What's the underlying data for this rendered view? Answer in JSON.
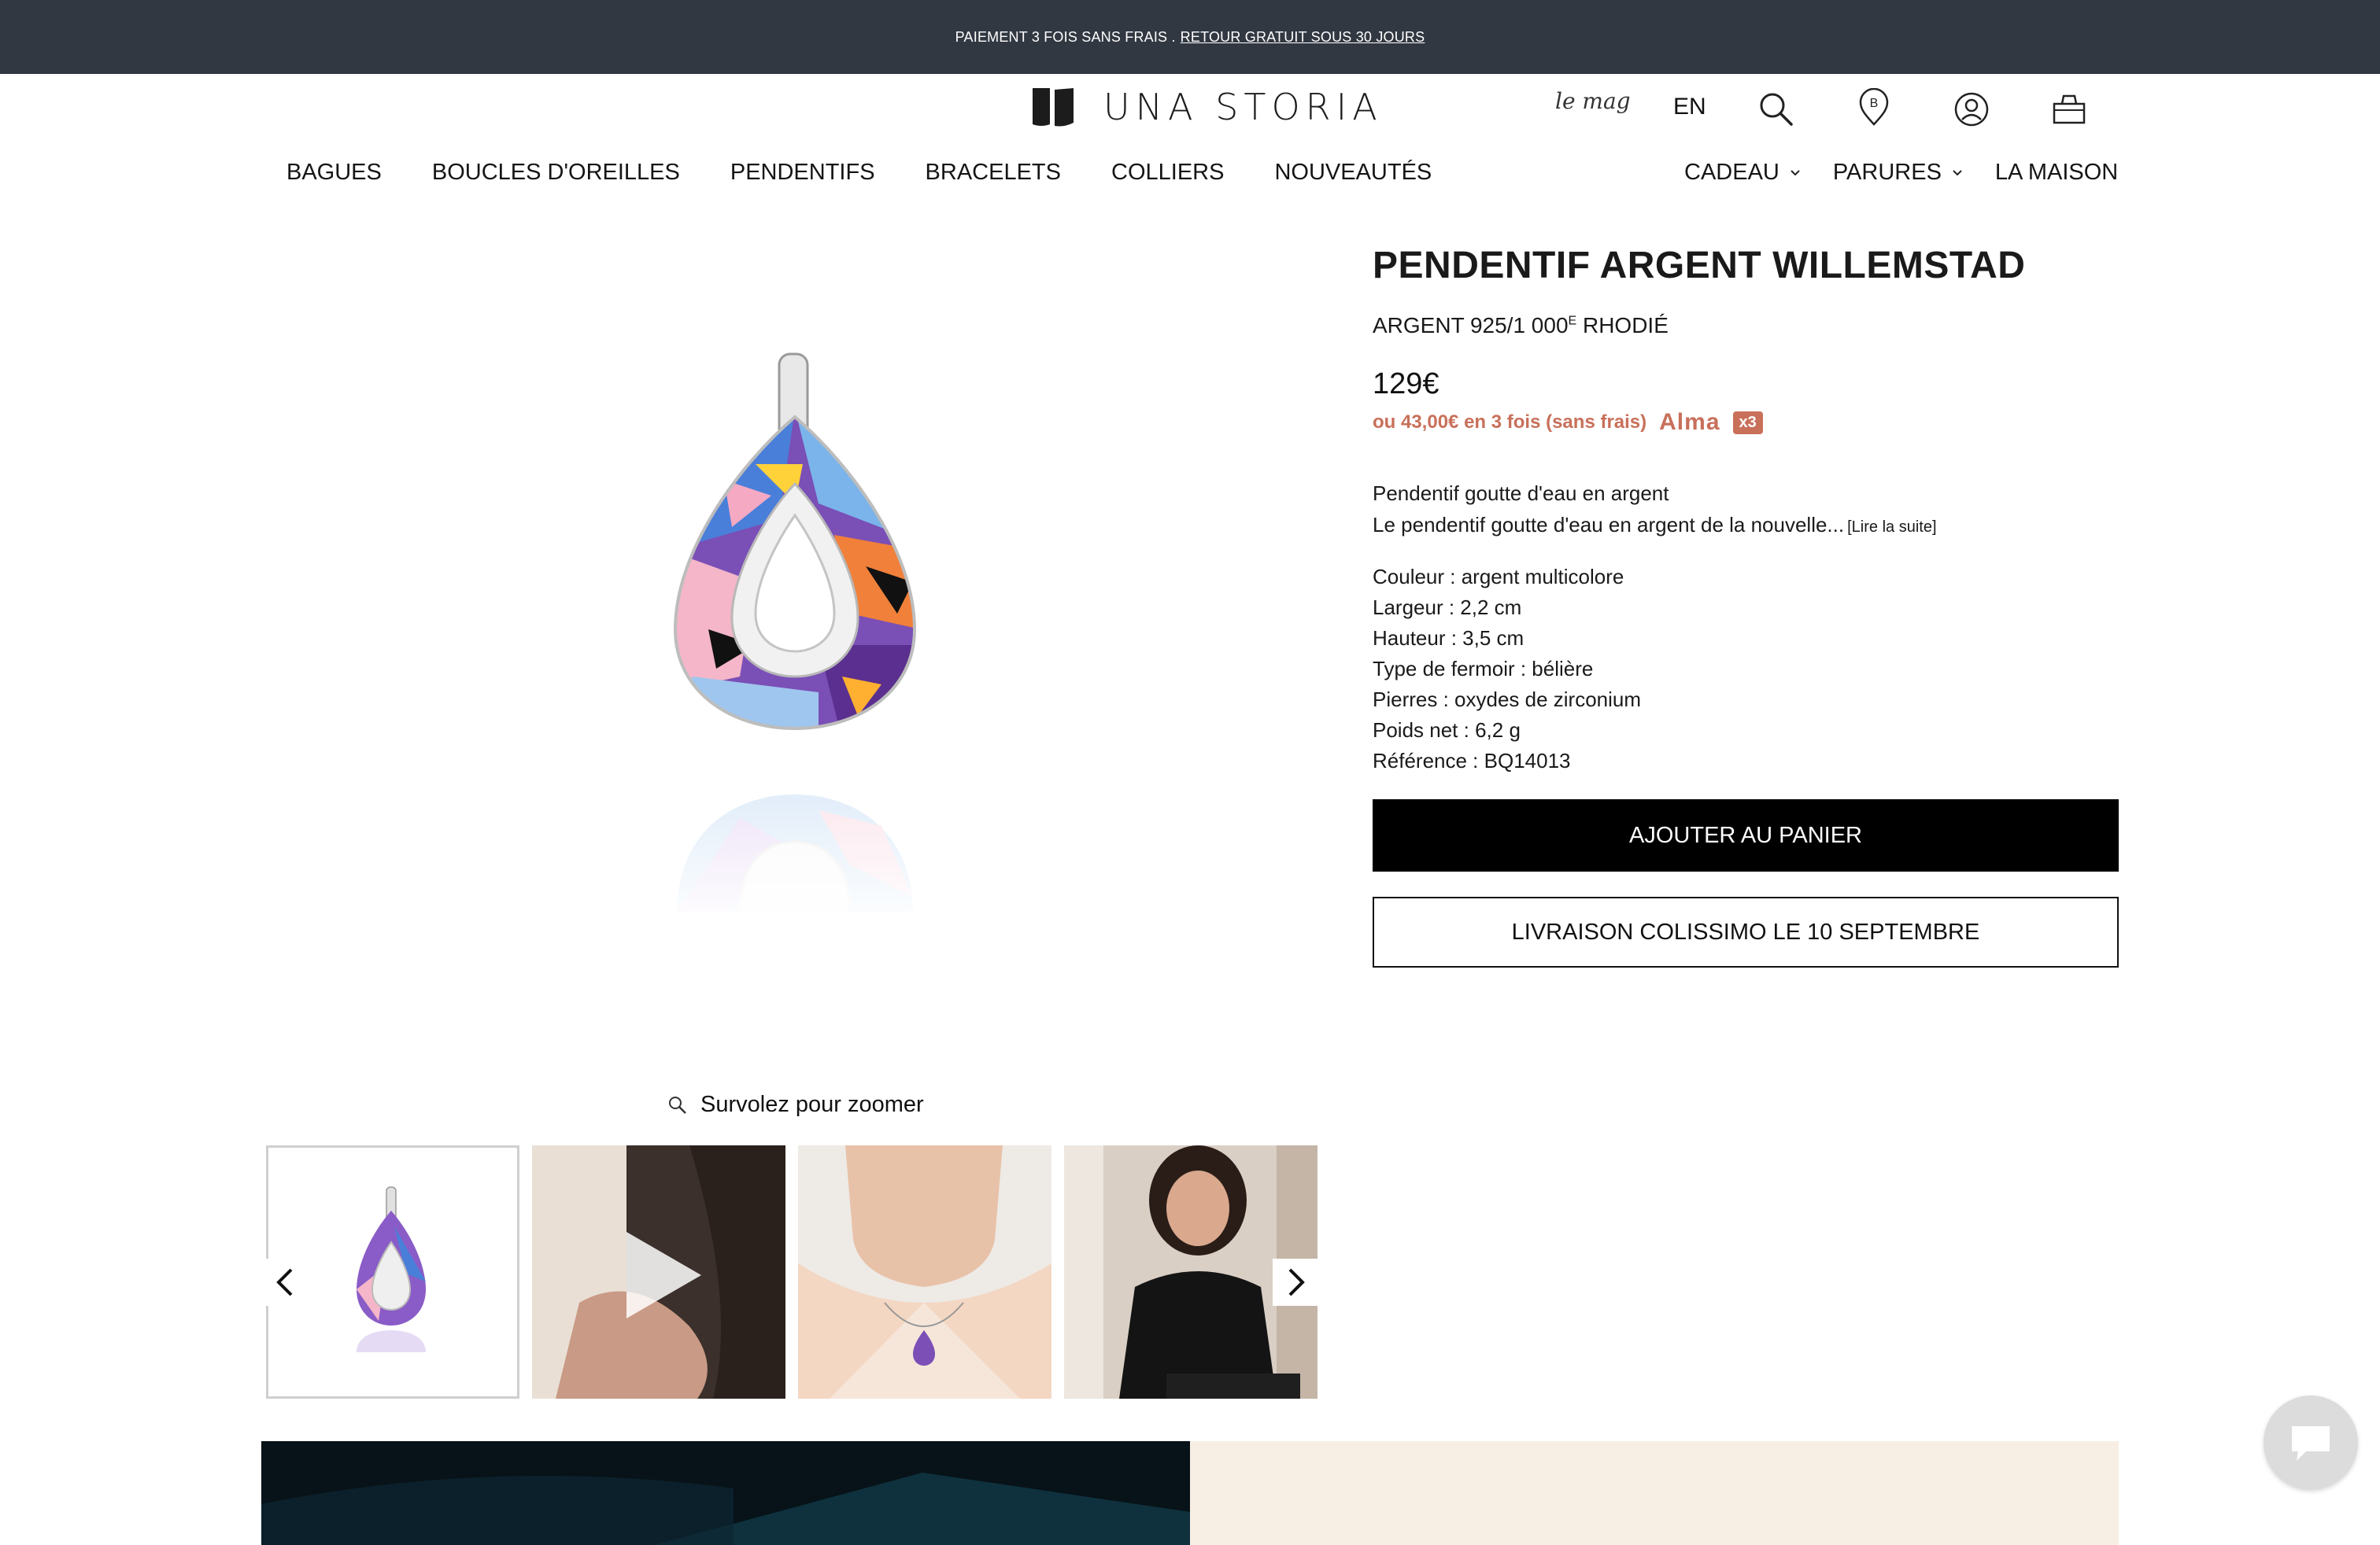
{
  "promo": {
    "text": "PAIEMENT 3 FOIS SANS FRAIS .",
    "link": "RETOUR GRATUIT SOUS 30 JOURS"
  },
  "header": {
    "brand": "UNA STORIA",
    "mag": "le mag",
    "lang": "EN"
  },
  "nav": {
    "left": [
      "BAGUES",
      "BOUCLES D'OREILLES",
      "PENDENTIFS",
      "BRACELETS",
      "COLLIERS",
      "NOUVEAUTÉS"
    ],
    "right": [
      "CADEAU",
      "PARURES",
      "LA MAISON"
    ]
  },
  "product": {
    "title": "PENDENTIF ARGENT WILLEMSTAD",
    "material_main": "ARGENT 925/1 000",
    "material_sup": "E",
    "material_end": " RHODIÉ",
    "price": "129€",
    "installments": "ou 43,00€ en 3 fois (sans frais)",
    "alma": "Alma",
    "alma_badge": "x3",
    "desc_line1": "Pendentif goutte d'eau en argent",
    "desc_line2": "Le pendentif goutte d'eau en argent de la nouvelle...",
    "read_more": "[Lire la suite]",
    "specs": [
      "Couleur : argent multicolore",
      "Largeur : 2,2 cm",
      "Hauteur : 3,5 cm",
      "Type de fermoir : bélière",
      "Pierres : oxydes de zirconium",
      "Poids net : 6,2 g",
      "Référence : BQ14013"
    ],
    "add_to_cart": "AJOUTER AU PANIER",
    "shipping": "LIVRAISON COLISSIMO LE 10 SEPTEMBRE"
  },
  "gallery": {
    "zoom_hint": "Survolez pour zoomer"
  },
  "colors": {
    "promo_bg": "#323842",
    "alma": "#c8705a",
    "button_dark": "#000000",
    "banner_dark": "#0c1a22",
    "banner_cream": "#f7efe4"
  }
}
